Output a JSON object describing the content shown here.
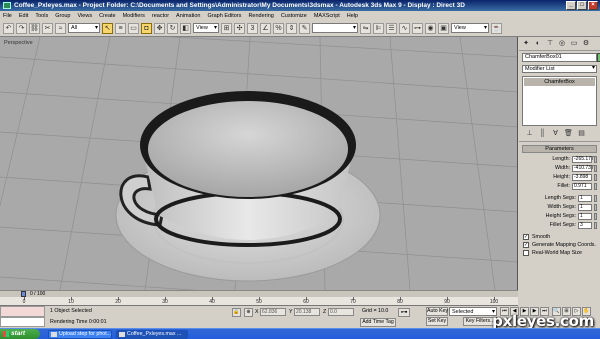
{
  "window": {
    "title": "Coffee_Pxleyes.max   - Project Folder: C:\\Documents and Settings\\Administrator\\My Documents\\3dsmax   - Autodesk 3ds Max 9   - Display : Direct 3D",
    "buttons": [
      "_",
      "□",
      "×"
    ]
  },
  "menu": [
    "File",
    "Edit",
    "Tools",
    "Group",
    "Views",
    "Create",
    "Modifiers",
    "reactor",
    "Animation",
    "Graph Editors",
    "Rendering",
    "Customize",
    "MAXScript",
    "Help"
  ],
  "toolbar": {
    "selection_filter": "All",
    "ref_coord": "View",
    "named_selection": "",
    "render_view": "View"
  },
  "viewport": {
    "label": "Perspective",
    "colors": {
      "background": "#a9a9a9",
      "grid": "#8c8c8c",
      "cup": "#d8d8d8",
      "cup_shadow": "#1a1a1a"
    }
  },
  "command_panel": {
    "object_name": "ChamferBox01",
    "object_color": "#6fbf6f",
    "modifier_list": "Modifier List",
    "stack": [
      "ChamferBox"
    ],
    "rollout_title": "Parameters",
    "params": [
      {
        "label": "Length:",
        "value": "-265.177"
      },
      {
        "label": "Width:",
        "value": "-410.737"
      },
      {
        "label": "Height:",
        "value": "-3.898"
      },
      {
        "label": "Fillet:",
        "value": "0.971"
      }
    ],
    "segs": [
      {
        "label": "Length Segs:",
        "value": "1"
      },
      {
        "label": "Width Segs:",
        "value": "1"
      },
      {
        "label": "Height Segs:",
        "value": "1"
      },
      {
        "label": "Fillet Segs:",
        "value": "3"
      }
    ],
    "checks": [
      {
        "label": "Smooth",
        "checked": true
      },
      {
        "label": "Generate Mapping Coords.",
        "checked": true
      },
      {
        "label": "Real-World Map Size",
        "checked": false
      }
    ]
  },
  "timeline": {
    "frame_text": "0 / 100",
    "ticks": [
      "0",
      "10",
      "20",
      "30",
      "40",
      "50",
      "60",
      "70",
      "80",
      "90",
      "100"
    ]
  },
  "status": {
    "selected": "1 Object Selected",
    "render_time": "Rendering Time  0:00:01",
    "x_label": "X",
    "x_value": "62.836",
    "y_label": "Y",
    "y_value": "20.138",
    "z_label": "Z",
    "z_value": "0.0",
    "grid": "Grid = 10.0",
    "add_time_tag": "Add Time Tag",
    "auto_key": "Auto Key",
    "set_key": "Set Key",
    "key_mode": "Selected",
    "key_filters": "Key Filters..."
  },
  "taskbar": {
    "start": "start",
    "tasks": [
      "Upload step for phot...",
      "Coffee_Pxleyes.max ..."
    ]
  },
  "watermark": "pxleyes.com"
}
